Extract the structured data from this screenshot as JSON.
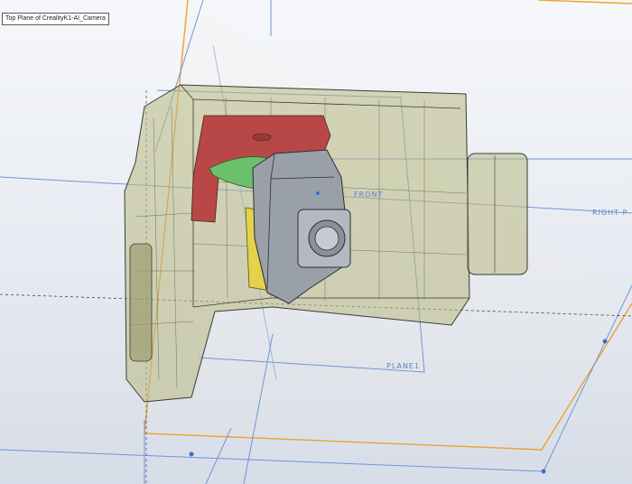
{
  "tooltip": {
    "text": "Top Plane of CrealityK1-AI_Camera"
  },
  "planes": {
    "plane1_label": "PLANE1",
    "right_label": "RIGHT P",
    "front_label": "FRONT"
  },
  "colors": {
    "orange_plane": "#f0a030",
    "blue_plane": "#6f94d8",
    "part_body": "#c8c89a",
    "bracket_red": "#b84848",
    "green_gear": "#6cc06c",
    "camera_grey": "#9aa0a8",
    "yellow_part": "#e3d24a"
  },
  "icons": [
    "origin-point-icon"
  ]
}
